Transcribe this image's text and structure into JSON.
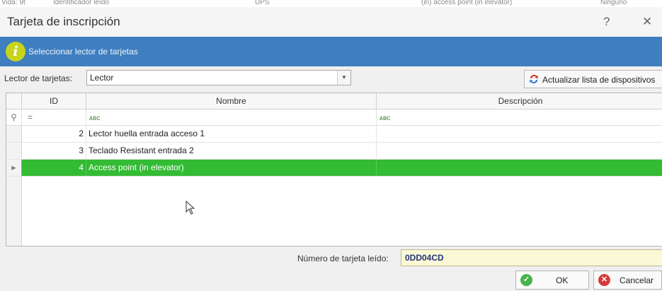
{
  "background_strip": [
    "Vida: 9t",
    "Identificador leído",
    "UPS",
    "(in) access point (in elevator)",
    "Ninguno"
  ],
  "dialog": {
    "title": "Tarjeta de inscripción",
    "help_label": "?",
    "close_label": "✕"
  },
  "banner": {
    "icon": "info-icon",
    "icon_glyph": "i",
    "text": "Seleccionar lector de tarjetas",
    "color": "#3f7ebf"
  },
  "reader": {
    "label": "Lector de tarjetas:",
    "value": "Lector",
    "refresh_label": "Actualizar lista de dispositivos"
  },
  "grid": {
    "columns": [
      "ID",
      "Nombre",
      "Descripción"
    ],
    "filter_ops": [
      "=",
      "ᴀʙc",
      "ᴀʙc"
    ],
    "rows": [
      {
        "id": "2",
        "nombre": "Lector huella entrada acceso 1",
        "descripcion": ""
      },
      {
        "id": "3",
        "nombre": "Teclado Resistant entrada 2",
        "descripcion": ""
      },
      {
        "id": "4",
        "nombre": "Access point (in elevator)",
        "descripcion": ""
      }
    ],
    "selected_row_color": "#33bb33"
  },
  "card": {
    "label": "Número de tarjeta leído:",
    "value": "0DD04CD"
  },
  "buttons": {
    "ok": "OK",
    "cancel": "Cancelar"
  }
}
